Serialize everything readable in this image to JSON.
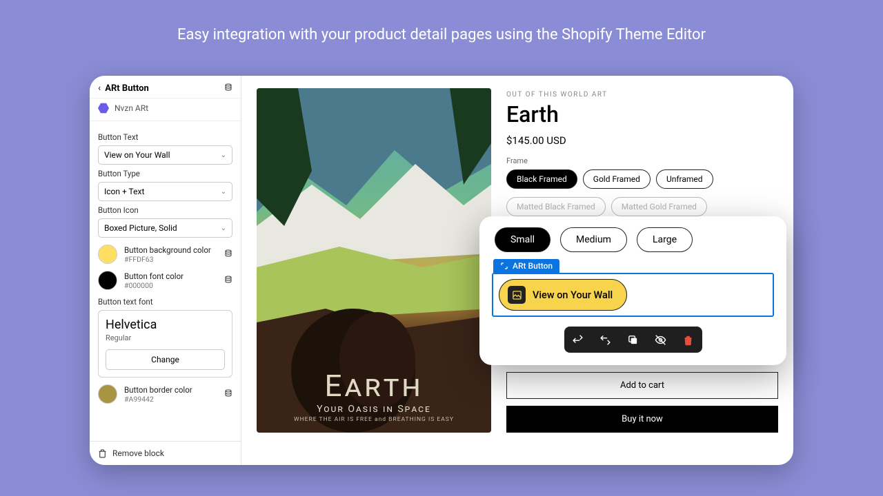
{
  "headline": "Easy integration with your product detail pages using the Shopify Theme Editor",
  "sidebar": {
    "title": "ARt Button",
    "app_name": "Nvzn ARt",
    "fields": {
      "button_text_label": "Button Text",
      "button_text_value": "View on Your Wall",
      "button_type_label": "Button Type",
      "button_type_value": "Icon + Text",
      "button_icon_label": "Button Icon",
      "button_icon_value": "Boxed Picture, Solid",
      "bg_color_label": "Button background color",
      "bg_color_hex": "#FFDF63",
      "font_color_label": "Button font color",
      "font_color_hex": "#000000",
      "text_font_label": "Button text font",
      "font_name": "Helvetica",
      "font_weight": "Regular",
      "change_label": "Change",
      "border_color_label": "Button border color",
      "border_color_hex": "#A99442"
    },
    "remove_label": "Remove block"
  },
  "product": {
    "eyebrow": "OUT OF THIS WORLD ART",
    "title": "Earth",
    "price": "$145.00 USD",
    "frame_label": "Frame",
    "frames": [
      "Black Framed",
      "Gold Framed",
      "Unframed"
    ],
    "frames_ghost": [
      "Matted Black Framed",
      "Matted Gold Framed"
    ],
    "add_to_cart": "Add to cart",
    "buy_now": "Buy it now",
    "poster_big": "Earth",
    "poster_tag": "Your Oasis in Space",
    "poster_sub": "WHERE THE AIR IS FREE and BREATHING IS EASY"
  },
  "popover": {
    "sizes": [
      "Small",
      "Medium",
      "Large"
    ],
    "block_label": "ARt Button",
    "ar_button_text": "View on Your Wall"
  }
}
